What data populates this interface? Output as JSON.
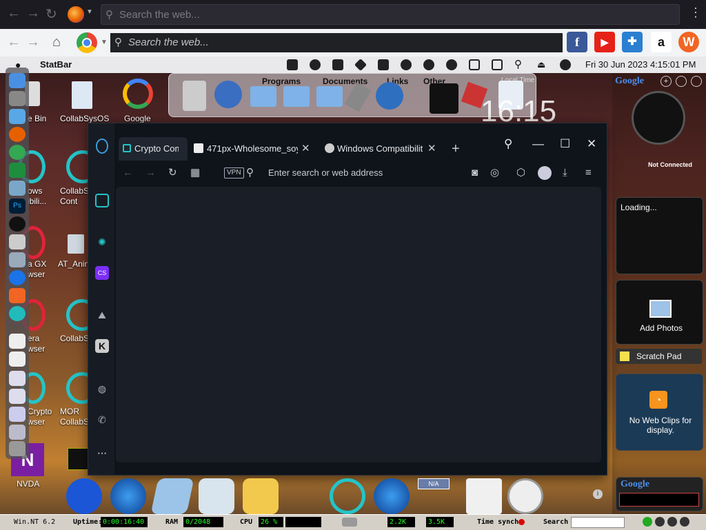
{
  "firefox_bar": {
    "search_placeholder": "Search the web..."
  },
  "chrome_bar": {
    "search_placeholder": "Search the web..."
  },
  "toolbar_icons": [
    "facebook-icon",
    "youtube-icon",
    "game-controller-icon",
    "amazon-icon",
    "w-icon"
  ],
  "menubar": {
    "app_name": "StatBar",
    "datetime": "Fri 30 Jun 2023 4:15:01 PM"
  },
  "shelf": {
    "tabs": [
      "Programs",
      "Documents",
      "Links",
      "Other"
    ],
    "clock_label": "Local Time",
    "big_clock": "16:15"
  },
  "desktop_icons": [
    {
      "label": "e Bin"
    },
    {
      "label": "CollabSysOS"
    },
    {
      "label": "Google"
    },
    {
      "label": "ows\nibili..."
    },
    {
      "label": "CollabS\nCont"
    },
    {
      "label": "a GX\nwser"
    },
    {
      "label": "AT_Anin"
    },
    {
      "label": "era\nwser"
    },
    {
      "label": "CollabS"
    },
    {
      "label": "Crypto\nwser"
    },
    {
      "label": "MOR\nCollabS"
    },
    {
      "label": "NVDA"
    }
  ],
  "browser": {
    "tabs": [
      {
        "label": "Crypto Com",
        "active": true
      },
      {
        "label": "471px-Wholesome_soyja",
        "active": false
      },
      {
        "label": "Windows Compatibility",
        "active": false
      }
    ],
    "address_placeholder": "Enter search or web address",
    "vpn_label": "VPN"
  },
  "gadgets": {
    "google_label": "Google",
    "not_connected": "Not Connected",
    "loading": "Loading...",
    "add_photos": "Add Photos",
    "scratch_pad": "Scratch Pad",
    "web_clips": "No Web Clips for display.",
    "google_search_label": "Google"
  },
  "statbar": {
    "win_nt": "Win.NT 6.2",
    "uptime_label": "Uptime:",
    "uptime_value": "0:00:16:40",
    "ram_label": "RAM",
    "ram_value": "0/2048",
    "cpu_label": "CPU",
    "cpu_value": "26 %",
    "net_down": "2.2K",
    "net_up": "3.5K",
    "time_sync": "Time synch.",
    "search_label": "Search"
  },
  "colors": {
    "accent": "#24c4c8",
    "browser_bg": "#0f141b",
    "statbar_bg": "#d4d0c8"
  }
}
